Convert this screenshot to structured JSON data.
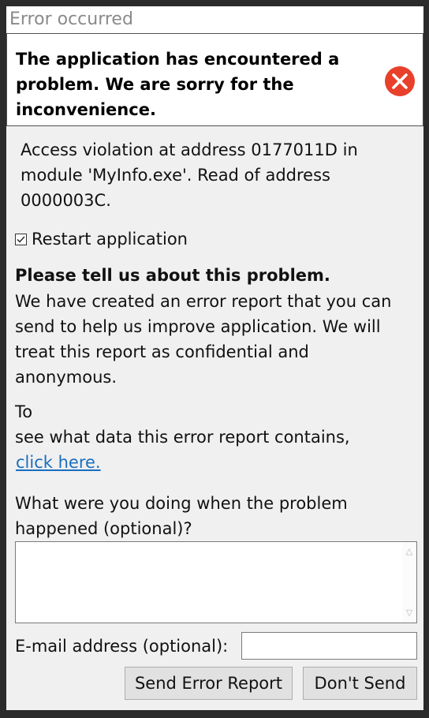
{
  "window": {
    "title": "Error occurred"
  },
  "header": {
    "message": "The application has encountered a problem. We are sorry for the inconvenience.",
    "icon": "error-circle-icon",
    "icon_color": "#e8402a"
  },
  "details": {
    "message": "Access violation at address 0177011D in module 'MyInfo.exe'. Read of address 0000003C."
  },
  "restart": {
    "label": "Restart application",
    "checked": true
  },
  "feedback": {
    "title": "Please tell us about this problem.",
    "body": "We have created an error report that you can send to help us improve application. We will treat this report as confidential and anonymous.",
    "to_text": "To",
    "see_text": "see what data this error report contains,",
    "link_text": "click here.",
    "question": "What were you doing when the problem happened (optional)?",
    "description_value": ""
  },
  "email": {
    "label": "E-mail address (optional):",
    "value": ""
  },
  "buttons": {
    "send": "Send Error Report",
    "dont_send": "Don't Send"
  },
  "colors": {
    "link": "#1a6fc0",
    "window_bg": "#f0f0f0",
    "frame": "#2b2b2b"
  }
}
